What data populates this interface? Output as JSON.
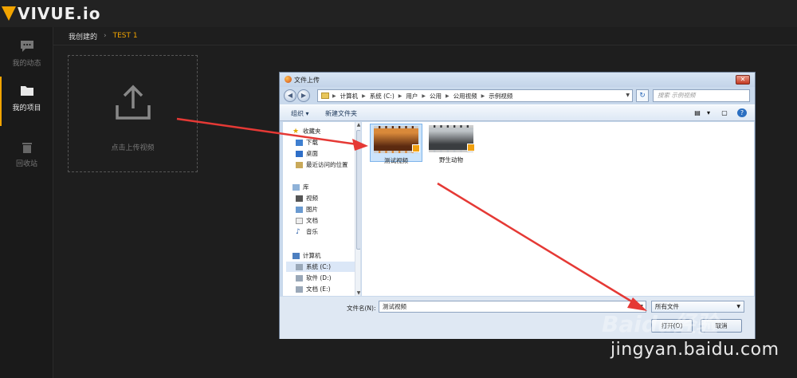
{
  "app": {
    "logo_text": "VIVUE.io",
    "brand_color": "#f2a400"
  },
  "sidebar": {
    "items": [
      {
        "label": "我的动态",
        "icon": "chat-icon",
        "active": false
      },
      {
        "label": "我的项目",
        "icon": "folder-icon",
        "active": true
      },
      {
        "label": "回收站",
        "icon": "trash-icon",
        "active": false
      }
    ]
  },
  "breadcrumb": {
    "parent": "我创建的",
    "separator": "›",
    "current": "TEST 1"
  },
  "upload": {
    "label": "点击上传视频",
    "icon": "upload-icon"
  },
  "dialog": {
    "title": "文件上传",
    "close_label": "✕",
    "address": {
      "segments": [
        "计算机",
        "系统 (C:)",
        "用户",
        "公用",
        "公用视频",
        "示例视频"
      ]
    },
    "search_placeholder": "搜索 示例视频",
    "toolbar": {
      "organize": "组织 ▾",
      "new_folder": "新建文件夹"
    },
    "tree": [
      {
        "label": "收藏夹",
        "icon": "star-icon",
        "indent": 0
      },
      {
        "label": "下载",
        "icon": "download-folder-icon",
        "indent": 1
      },
      {
        "label": "桌面",
        "icon": "desktop-icon",
        "indent": 1
      },
      {
        "label": "最近访问的位置",
        "icon": "recent-icon",
        "indent": 1
      },
      {
        "label": "库",
        "icon": "library-icon",
        "indent": 0
      },
      {
        "label": "视频",
        "icon": "video-icon",
        "indent": 1
      },
      {
        "label": "图片",
        "icon": "picture-icon",
        "indent": 1
      },
      {
        "label": "文档",
        "icon": "document-icon",
        "indent": 1
      },
      {
        "label": "音乐",
        "icon": "music-icon",
        "indent": 1
      },
      {
        "label": "计算机",
        "icon": "computer-icon",
        "indent": 0
      },
      {
        "label": "系统 (C:)",
        "icon": "drive-icon",
        "indent": 1,
        "selected": true
      },
      {
        "label": "软件 (D:)",
        "icon": "drive-icon",
        "indent": 1
      },
      {
        "label": "文档 (E:)",
        "icon": "drive-icon",
        "indent": 1
      }
    ],
    "files": [
      {
        "name": "测试视频",
        "selected": true
      },
      {
        "name": "野生动物",
        "selected": false
      }
    ],
    "filename_label": "文件名(N):",
    "filename_value": "测试视频",
    "filetype_value": "所有文件",
    "open_label": "打开(O)",
    "cancel_label": "取消"
  },
  "watermark": {
    "logo": "Baidu经验",
    "url": "jingyan.baidu.com"
  }
}
